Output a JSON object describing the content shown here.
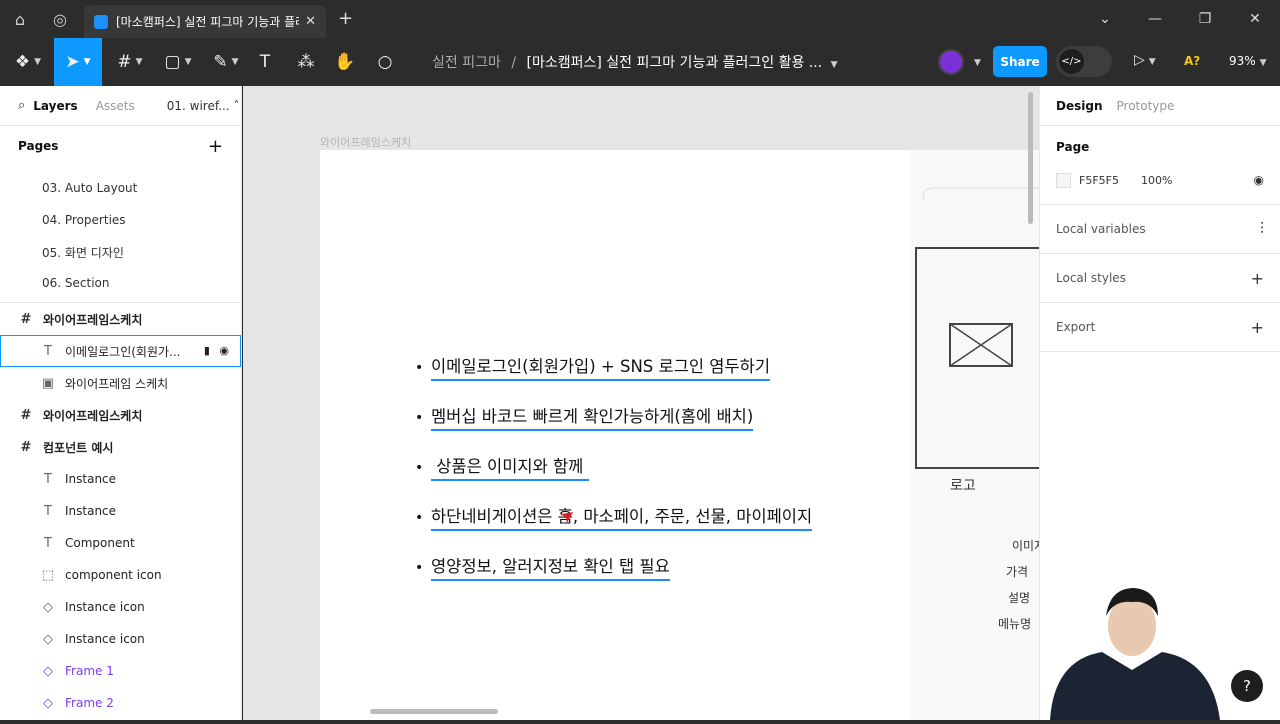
{
  "browser": {
    "tab_title": "[마소캠퍼스] 실전 피그마 기능과 플러",
    "tab_close": "✕",
    "new_tab": "+",
    "home_icon": "⌂",
    "globe_icon": "◎",
    "window_controls": [
      "⌄",
      "—",
      "❐",
      "✕"
    ]
  },
  "toolbar": {
    "figma_menu_icon": "❖",
    "move_tool": "➤",
    "frame_tool": "#",
    "shape_tool": "▢",
    "pen_tool": "✎",
    "text_tool": "T",
    "resources_tool": "⁂",
    "hand_tool": "✋",
    "comment_tool": "○",
    "project": "실전 피그마",
    "separator": "/",
    "file_name": "[마소캠퍼스] 실전 피그마 기능과 플러그인 활용 ...",
    "share_label": "Share",
    "dev_mode_icon": "</>",
    "present_icon": "▷",
    "a11y_label": "A?",
    "zoom_level": "93%"
  },
  "left_panel": {
    "tabs": {
      "layers": "Layers",
      "assets": "Assets",
      "page_selector": "01. wiref... ˄"
    },
    "pages_header": "Pages",
    "add_page": "+",
    "pages": [
      "03. Auto Layout",
      "04. Properties",
      "05. 화면 디자인",
      "06. Section"
    ],
    "layers": [
      {
        "type": "frame",
        "icon": "#",
        "label": "와이어프레임스케치"
      },
      {
        "type": "text-child",
        "icon": "T",
        "label": "이메일로그인(회원가...",
        "selected": true
      },
      {
        "type": "image-child",
        "icon": "▣",
        "label": "와이어프레임 스케치"
      },
      {
        "type": "frame",
        "icon": "#",
        "label": "와이어프레임스케치"
      },
      {
        "type": "frame",
        "icon": "#",
        "label": "컴포넌트 예시"
      },
      {
        "type": "text-child",
        "icon": "T",
        "label": "Instance"
      },
      {
        "type": "text-child",
        "icon": "T",
        "label": "Instance"
      },
      {
        "type": "text-child",
        "icon": "T",
        "label": "Component"
      },
      {
        "type": "dashed-child",
        "icon": "⬚",
        "label": "component icon"
      },
      {
        "type": "instance-child",
        "icon": "◇",
        "label": "Instance icon"
      },
      {
        "type": "instance-child",
        "icon": "◇",
        "label": "Instance icon"
      },
      {
        "type": "component-child",
        "icon": "◇",
        "label": "Frame 1"
      },
      {
        "type": "component-child",
        "icon": "◇",
        "label": "Frame 2"
      }
    ],
    "lock_icon": "🔓",
    "eye_icon": "👁"
  },
  "canvas": {
    "frame_label": "와이어프레임스케치",
    "bullets": [
      "이메일로그인(회원가입) + SNS 로그인 염두하기",
      "멤버십 바코드 빠르게 확인가능하게(홈에 배치)",
      " 상품은 이미지와 함께 ",
      "하단네비게이션은 홈, 마소페이, 주문, 선물, 마이페이지",
      "영양정보, 알러지정보 확인 탭 필요"
    ],
    "sketch_text_logo": "로고",
    "sketch_text_lines": [
      "이미지",
      "가격",
      "설명",
      "메뉴명"
    ],
    "cursor_icon": "➤",
    "underline_color": "#1a8cff"
  },
  "right_panel": {
    "tabs": {
      "design": "Design",
      "prototype": "Prototype"
    },
    "page_section": "Page",
    "bg_color_hex": "F5F5F5",
    "bg_opacity": "100%",
    "visibility_icon": "👁",
    "local_variables": "Local variables",
    "local_variables_icon": "⚙",
    "local_styles": "Local styles",
    "export": "Export",
    "add_icon": "+"
  },
  "help_icon": "?",
  "colors": {
    "accent": "#0d99ff",
    "toolbar_bg": "#2c2c2c",
    "canvas_bg": "#e5e5e5",
    "component_purple": "#7b3ff2"
  }
}
